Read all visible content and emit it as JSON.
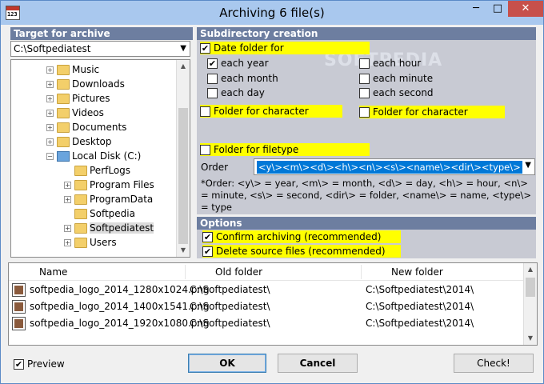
{
  "window": {
    "title": "Archiving 6 file(s)",
    "minimize": "─",
    "maximize": "□",
    "close": "✕"
  },
  "app_icon": {
    "digits": "123"
  },
  "left": {
    "header": "Target for archive",
    "path": "C:\\Softpediatest",
    "tree": [
      {
        "label": "Music",
        "icon": "music-folder-icon"
      },
      {
        "label": "Downloads",
        "icon": "downloads-folder-icon"
      },
      {
        "label": "Pictures",
        "icon": "pictures-folder-icon"
      },
      {
        "label": "Videos",
        "icon": "videos-folder-icon"
      },
      {
        "label": "Documents",
        "icon": "documents-folder-icon"
      },
      {
        "label": "Desktop",
        "icon": "desktop-folder-icon"
      },
      {
        "label": "Local Disk (C:)",
        "icon": "local-disk-icon"
      },
      {
        "label": "PerfLogs",
        "icon": "folder-icon"
      },
      {
        "label": "Program Files",
        "icon": "folder-icon"
      },
      {
        "label": "ProgramData",
        "icon": "folder-icon"
      },
      {
        "label": "Softpedia",
        "icon": "folder-icon"
      },
      {
        "label": "Softpediatest",
        "icon": "folder-icon"
      },
      {
        "label": "Users",
        "icon": "folder-icon"
      }
    ]
  },
  "subdir": {
    "header": "Subdirectory creation",
    "watermark": "SOFTPEDIA",
    "date_folder": "Date folder for",
    "each_year": "each year",
    "each_month": "each month",
    "each_day": "each day",
    "each_hour": "each hour",
    "each_minute": "each minute",
    "each_second": "each second",
    "folder_char_1": "Folder for character",
    "folder_char_2": "Folder for character",
    "folder_filetype": "Folder for filetype",
    "order_label": "Order",
    "order_value": "<y\\><m\\><d\\><h\\><n\\><s\\><name\\><dir\\><type\\>",
    "order_help": "*Order: <y\\> = year, <m\\> = month, <d\\> = day, <h\\> = hour, <n\\> = minute, <s\\> = second, <dir\\> = folder, <name\\> = name, <type\\> = type"
  },
  "options": {
    "header": "Options",
    "confirm": "Confirm archiving (recommended)",
    "delete": "Delete source files (recommended)"
  },
  "files": {
    "col_name": "Name",
    "col_old": "Old folder",
    "col_new": "New folder",
    "rows": [
      {
        "name": "softpedia_logo_2014_1280x1024.png",
        "old": "C:\\Softpediatest\\",
        "new": "C:\\Softpediatest\\2014\\"
      },
      {
        "name": "softpedia_logo_2014_1400x1541.png",
        "old": "C:\\Softpediatest\\",
        "new": "C:\\Softpediatest\\2014\\"
      },
      {
        "name": "softpedia_logo_2014_1920x1080.png",
        "old": "C:\\Softpediatest\\",
        "new": "C:\\Softpediatest\\2014\\"
      }
    ]
  },
  "footer": {
    "preview": "Preview",
    "ok": "OK",
    "cancel": "Cancel",
    "check": "Check!"
  },
  "checks": {
    "date_folder": true,
    "each_year": true,
    "each_month": false,
    "each_day": false,
    "each_hour": false,
    "each_minute": false,
    "each_second": false,
    "folder_char_1": false,
    "folder_char_2": false,
    "folder_filetype": false,
    "confirm": true,
    "delete": true,
    "preview": true
  },
  "colors": {
    "highlight": "#ffff00",
    "panel_header": "#6d7ea0",
    "panel_bg": "#c8cad3",
    "selection": "#0078d7",
    "close": "#c7504b"
  }
}
